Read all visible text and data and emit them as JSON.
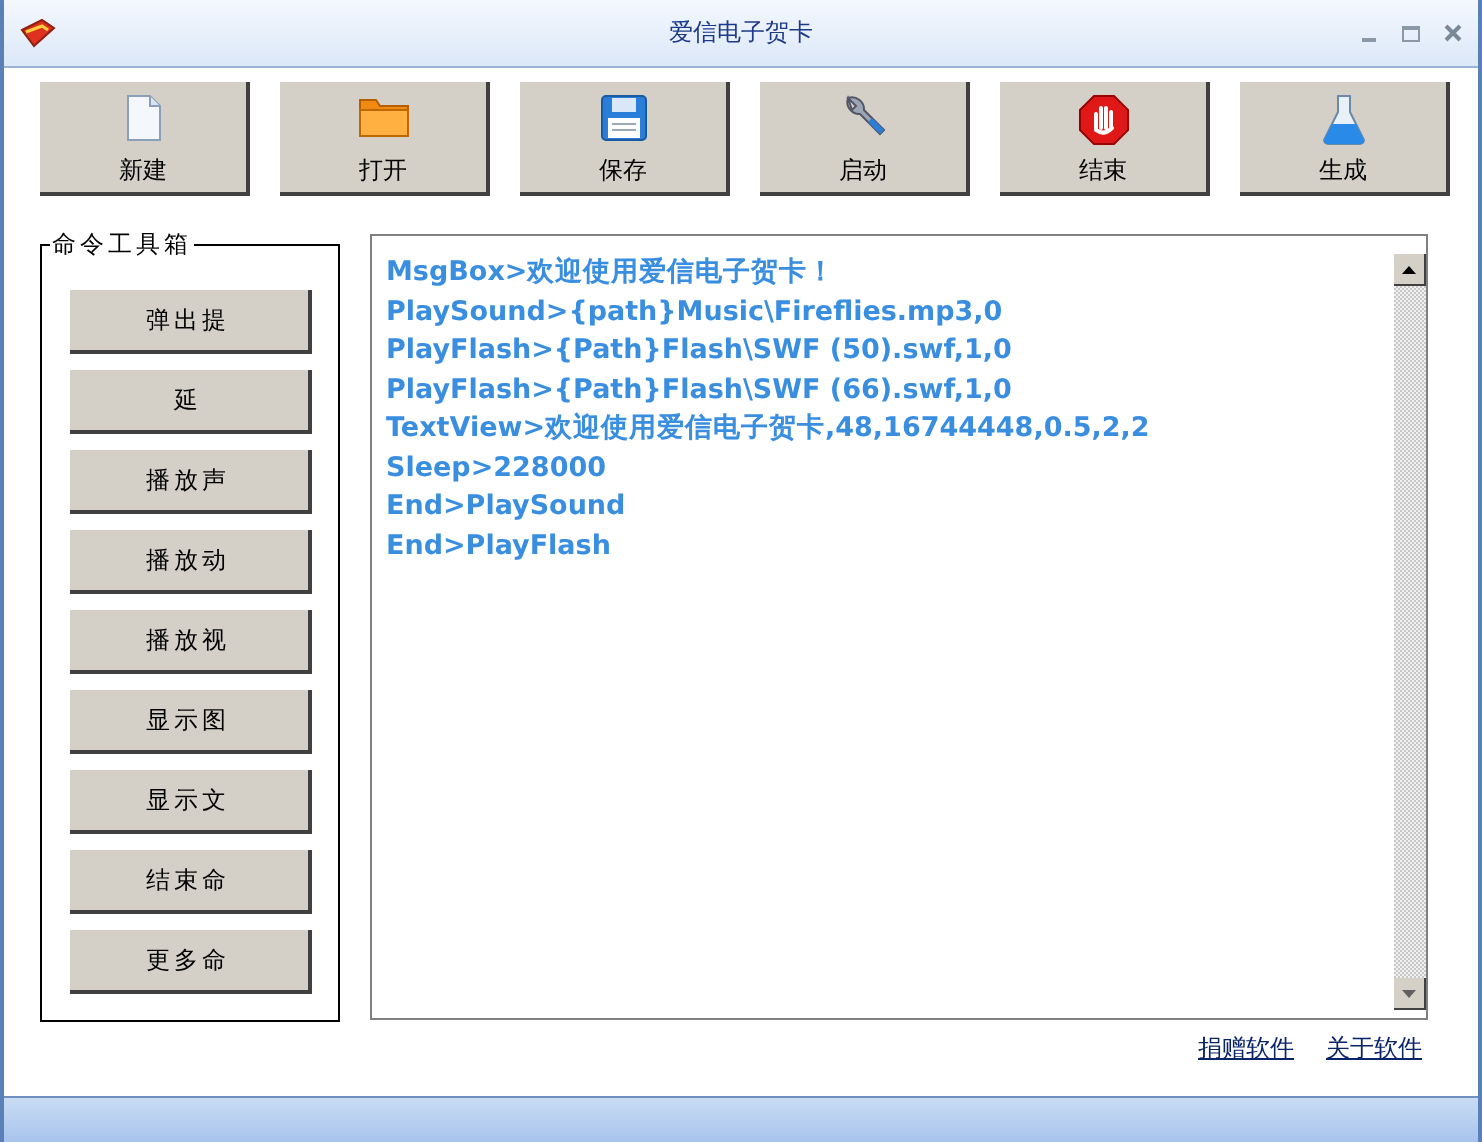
{
  "window": {
    "title": "爱信电子贺卡"
  },
  "toolbar": [
    {
      "label": "新建"
    },
    {
      "label": "打开"
    },
    {
      "label": "保存"
    },
    {
      "label": "启动"
    },
    {
      "label": "结束"
    },
    {
      "label": "生成"
    }
  ],
  "command_toolbox": {
    "title": "命令工具箱",
    "buttons": [
      "弹出提",
      "延",
      "播放声",
      "播放动",
      "播放视",
      "显示图",
      "显示文",
      "结束命",
      "更多命"
    ]
  },
  "script_lines": [
    "MsgBox>欢迎使用爱信电子贺卡！",
    "PlaySound>{path}Music\\Fireflies.mp3,0",
    "PlayFlash>{Path}Flash\\SWF (50).swf,1,0",
    "PlayFlash>{Path}Flash\\SWF (66).swf,1,0",
    "TextView>欢迎使用爱信电子贺卡,48,16744448,0.5,2,2",
    "Sleep>228000",
    "End>PlaySound",
    "End>PlayFlash"
  ],
  "links": [
    "捐赠软件",
    "关于软件"
  ]
}
